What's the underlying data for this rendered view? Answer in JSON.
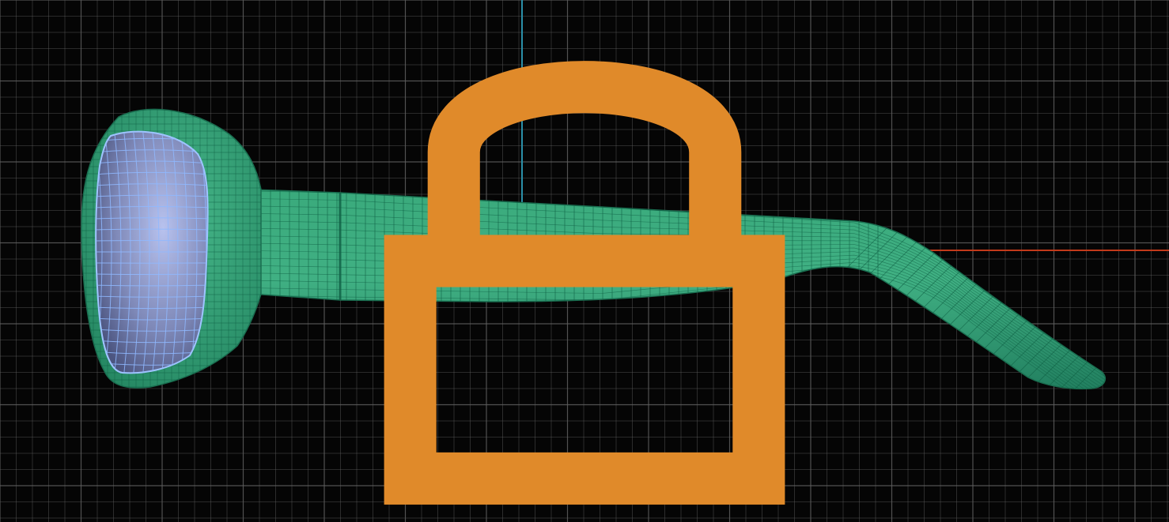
{
  "viewport": {
    "background_color": "#050505",
    "grid_line_color": "#5f5f5f",
    "axis_vertical_color": "#2a8fa8",
    "axis_horizontal_color": "#c23a1a",
    "mesh_fill_color": "#2f9e73",
    "mesh_wire_color": "#0f5f44",
    "lens_fill_color": "#8c98c8",
    "lens_wire_color": "#8fb8ff",
    "corner_icon_color": "#e08a2a",
    "corner_icon": "lock-icon",
    "model": "sunglasses-side-view"
  }
}
